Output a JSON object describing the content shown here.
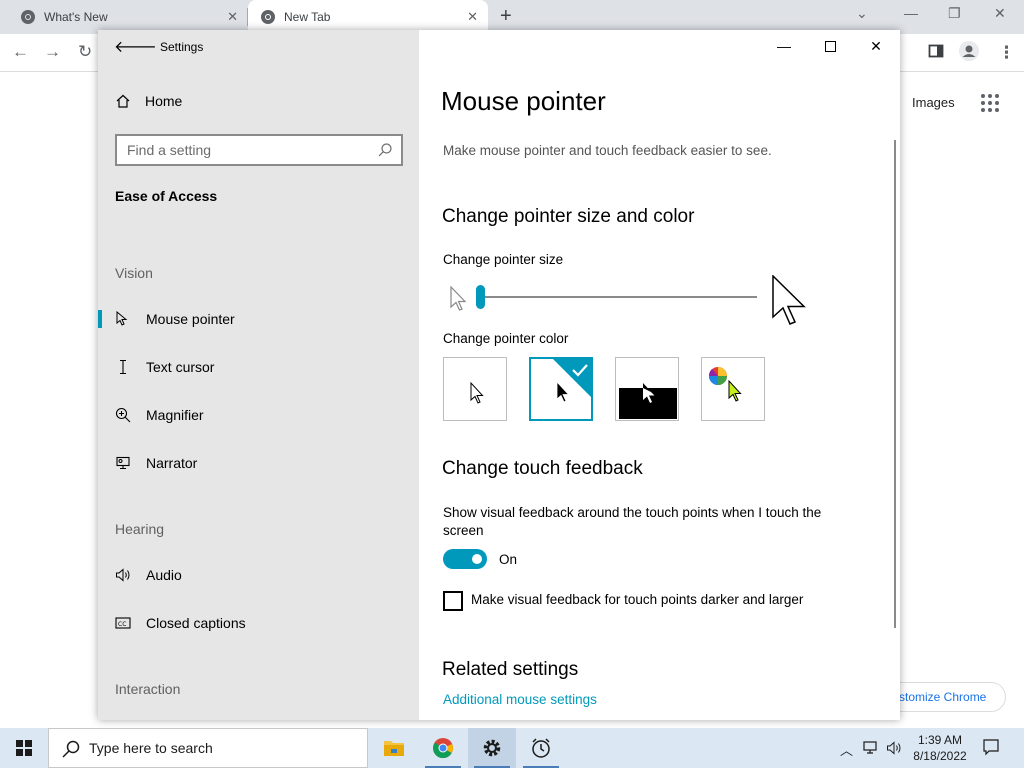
{
  "browser": {
    "tabs": [
      {
        "title": "What's New",
        "active": false
      },
      {
        "title": "New Tab",
        "active": true
      }
    ],
    "images_link": "Images",
    "customize_label": "Customize Chrome",
    "customize_visible": "stomize Chrome"
  },
  "settings": {
    "window_title": "Settings",
    "nav": {
      "home": "Home",
      "search_placeholder": "Find a setting",
      "group_title": "Ease of Access",
      "sections": [
        {
          "title": "Vision",
          "items": [
            "Mouse pointer",
            "Text cursor",
            "Magnifier",
            "Narrator"
          ]
        },
        {
          "title": "Hearing",
          "items": [
            "Audio",
            "Closed captions"
          ]
        },
        {
          "title": "Interaction",
          "items": []
        }
      ],
      "active_item": "Mouse pointer"
    },
    "page": {
      "title": "Mouse pointer",
      "description": "Make mouse pointer and touch feedback easier to see.",
      "size_color_heading": "Change pointer size and color",
      "size_label": "Change pointer size",
      "size_value": 0,
      "color_label": "Change pointer color",
      "color_options": [
        "white",
        "black",
        "inverted",
        "custom"
      ],
      "selected_color": "black",
      "touch_heading": "Change touch feedback",
      "touch_desc": "Show visual feedback around the touch points when I touch the screen",
      "toggle_state": "On",
      "checkbox_label": "Make visual feedback for touch points darker and larger",
      "checkbox_checked": false,
      "related_heading": "Related settings",
      "related_link": "Additional mouse settings"
    },
    "accent_color": "#0099bc"
  },
  "taskbar": {
    "search_placeholder": "Type here to search",
    "apps": [
      "file-explorer",
      "chrome",
      "settings",
      "alarms-clock"
    ],
    "time": "1:39 AM",
    "date": "8/18/2022"
  }
}
